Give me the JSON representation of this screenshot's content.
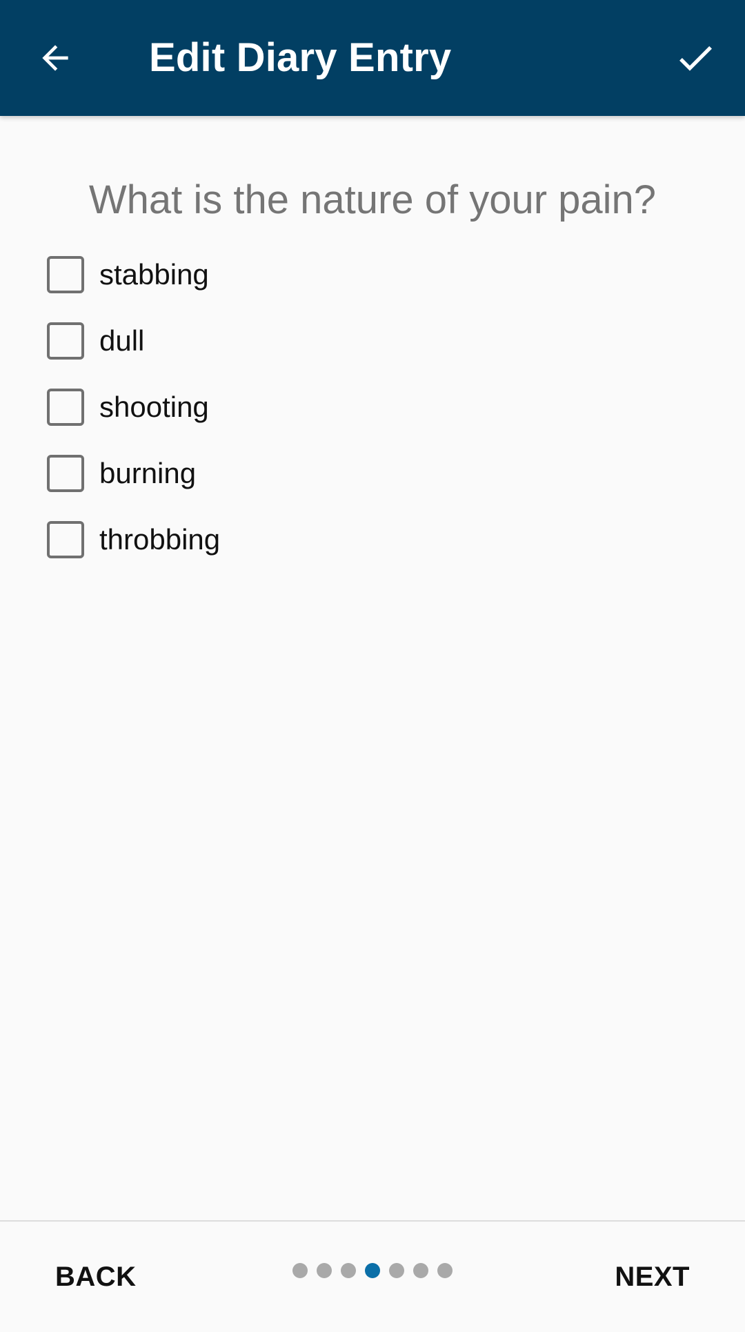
{
  "app_bar": {
    "title": "Edit Diary Entry",
    "back_icon": "arrow-back-icon",
    "confirm_icon": "check-icon",
    "background_color": "#023f63"
  },
  "question": {
    "text": "What is the nature of your pain?"
  },
  "options": [
    {
      "label": "stabbing",
      "checked": false
    },
    {
      "label": "dull",
      "checked": false
    },
    {
      "label": "shooting",
      "checked": false
    },
    {
      "label": "burning",
      "checked": false
    },
    {
      "label": "throbbing",
      "checked": false
    }
  ],
  "footer": {
    "back_label": "BACK",
    "next_label": "NEXT",
    "page_indicator": {
      "total": 7,
      "current": 4,
      "active_color": "#0b6fa8",
      "inactive_color": "#a9a9a9"
    }
  }
}
